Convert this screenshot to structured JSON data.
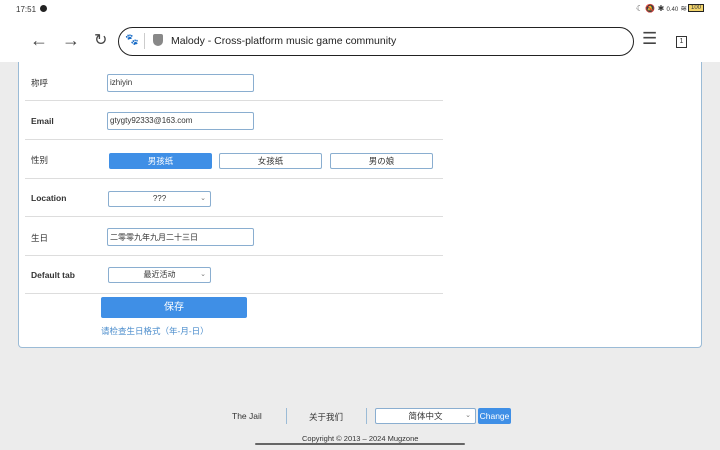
{
  "status_bar": {
    "time": "17:51",
    "battery": "100",
    "net": "0.40"
  },
  "browser": {
    "page_title": "Malody - Cross-platform music game community",
    "tab_count": "1"
  },
  "form": {
    "nickname": {
      "label": "称呼",
      "value": "izhiyin"
    },
    "email": {
      "label": "Email",
      "value": "gtygty92333@163.com"
    },
    "gender": {
      "label": "性别",
      "options": [
        "男孩纸",
        "女孩纸",
        "男の娘"
      ],
      "selected": 0
    },
    "location": {
      "label": "Location",
      "value": "???"
    },
    "birthday": {
      "label": "生日",
      "value": "二零零九年九月二十三日"
    },
    "default_tab": {
      "label": "Default tab",
      "value": "最近活动"
    },
    "save_label": "保存",
    "error": "请检查生日格式（年-月-日）"
  },
  "footer": {
    "jail": "The Jail",
    "about": "关于我们",
    "language": "简体中文",
    "change": "Change",
    "copyright": "Copyright © 2013 – 2024 Mugzone"
  },
  "colors": {
    "accent": "#3f8fe6"
  }
}
